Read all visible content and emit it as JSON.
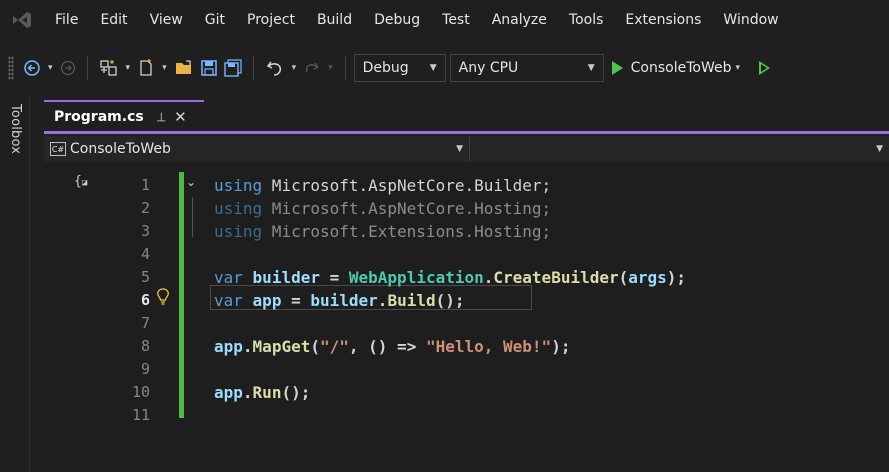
{
  "menu": [
    "File",
    "Edit",
    "View",
    "Git",
    "Project",
    "Build",
    "Debug",
    "Test",
    "Analyze",
    "Tools",
    "Extensions",
    "Window"
  ],
  "toolbar": {
    "configuration": "Debug",
    "platform": "Any CPU",
    "startup_project": "ConsoleToWeb"
  },
  "toolbox_label": "Toolbox",
  "tab": {
    "file_name": "Program.cs",
    "pin_glyph": "⊣",
    "close_glyph": "✕"
  },
  "navbar": {
    "project": "ConsoleToWeb",
    "cs_badge": "C#"
  },
  "editor": {
    "current_line": 6,
    "lines": [
      {
        "n": "1",
        "dim": false,
        "tokens": [
          [
            "kw",
            "using"
          ],
          [
            "p",
            " Microsoft.AspNetCore.Builder;"
          ]
        ]
      },
      {
        "n": "2",
        "dim": true,
        "tokens": [
          [
            "kw",
            "using"
          ],
          [
            "p",
            " Microsoft.AspNetCore.Hosting;"
          ]
        ]
      },
      {
        "n": "3",
        "dim": true,
        "tokens": [
          [
            "kw",
            "using"
          ],
          [
            "p",
            " Microsoft.Extensions.Hosting;"
          ]
        ]
      },
      {
        "n": "4",
        "dim": false,
        "tokens": []
      },
      {
        "n": "5",
        "dim": false,
        "tokens": [
          [
            "kw",
            "var"
          ],
          [
            "p",
            " "
          ],
          [
            "var",
            "builder"
          ],
          [
            "p",
            " = "
          ],
          [
            "ty",
            "WebApplication"
          ],
          [
            "p",
            "."
          ],
          [
            "fn",
            "CreateBuilder"
          ],
          [
            "p",
            "("
          ],
          [
            "var",
            "args"
          ],
          [
            "p",
            ");"
          ]
        ]
      },
      {
        "n": "6",
        "dim": false,
        "tokens": [
          [
            "kw",
            "var"
          ],
          [
            "p",
            " "
          ],
          [
            "var",
            "app"
          ],
          [
            "p",
            " = "
          ],
          [
            "var",
            "builder"
          ],
          [
            "p",
            "."
          ],
          [
            "fn",
            "Build"
          ],
          [
            "p",
            "();"
          ]
        ]
      },
      {
        "n": "7",
        "dim": false,
        "tokens": []
      },
      {
        "n": "8",
        "dim": false,
        "tokens": [
          [
            "var",
            "app"
          ],
          [
            "p",
            "."
          ],
          [
            "fn",
            "MapGet"
          ],
          [
            "p",
            "("
          ],
          [
            "str",
            "\"/\""
          ],
          [
            "p",
            ", () => "
          ],
          [
            "str",
            "\"Hello, Web!\""
          ],
          [
            "p",
            ");"
          ]
        ]
      },
      {
        "n": "9",
        "dim": false,
        "tokens": []
      },
      {
        "n": "10",
        "dim": false,
        "tokens": [
          [
            "var",
            "app"
          ],
          [
            "p",
            "."
          ],
          [
            "fn",
            "Run"
          ],
          [
            "p",
            "();"
          ]
        ]
      },
      {
        "n": "11",
        "dim": false,
        "tokens": []
      }
    ]
  }
}
